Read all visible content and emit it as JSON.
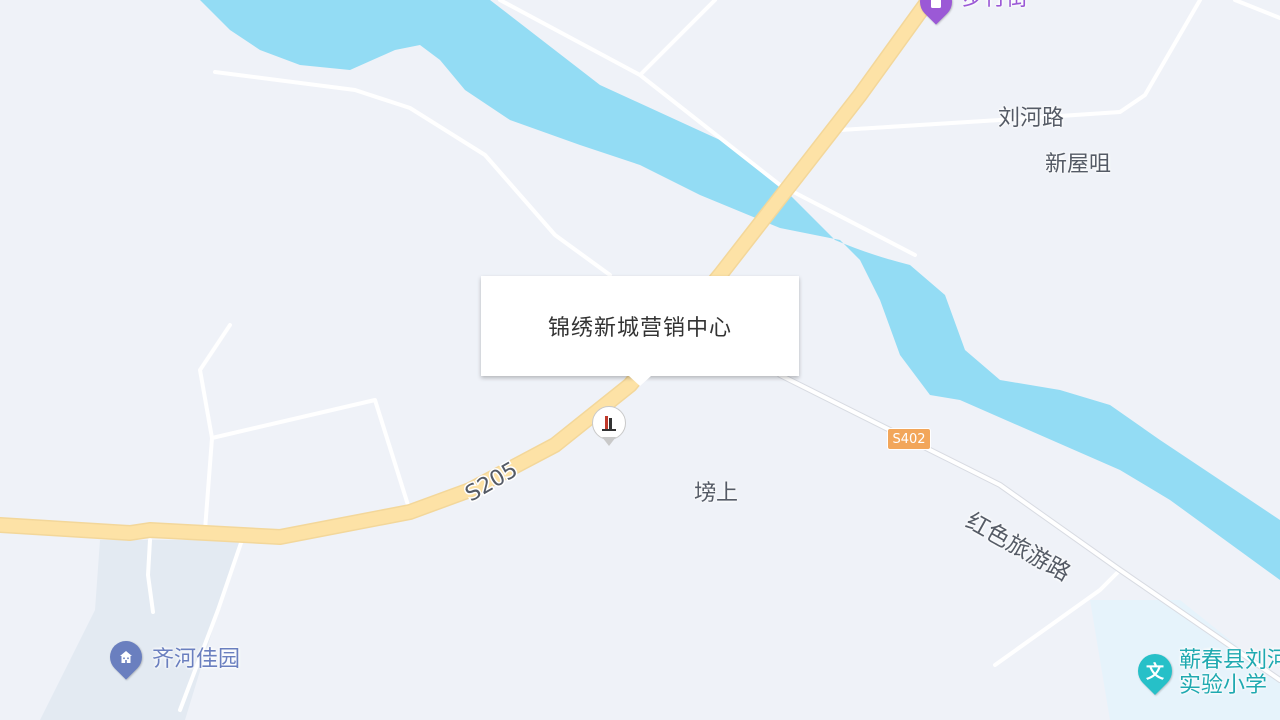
{
  "map": {
    "popup_title": "锦绣新城营销中心",
    "marker_icon": "building-logo-icon",
    "colors": {
      "land": "#eff2f8",
      "water": "#93dcf4",
      "road_major": "#fde2a6",
      "road_minor": "#ffffff",
      "green_area": "#e3eaf2",
      "route_shield": "#f2a65a"
    },
    "routes": {
      "s205": "S205",
      "s402": "S402"
    },
    "labels": {
      "liuhe_road": "刘河路",
      "xinwu_zui": "新屋咀",
      "bang_shang": "塝上",
      "red_tour_road": "红色旅游路"
    },
    "pois": {
      "pedestrian_street": {
        "name": "步行街",
        "icon": "shopping-bag-icon",
        "color": "#9b59d6"
      },
      "qihe_jiayuan": {
        "name": "齐河佳园",
        "icon": "residential-icon",
        "color": "#6a7fbf"
      },
      "school": {
        "name_line1": "蕲春县刘河",
        "name_line2": "实验小学",
        "icon": "school-wen-icon",
        "color": "#26c0c8"
      }
    }
  }
}
